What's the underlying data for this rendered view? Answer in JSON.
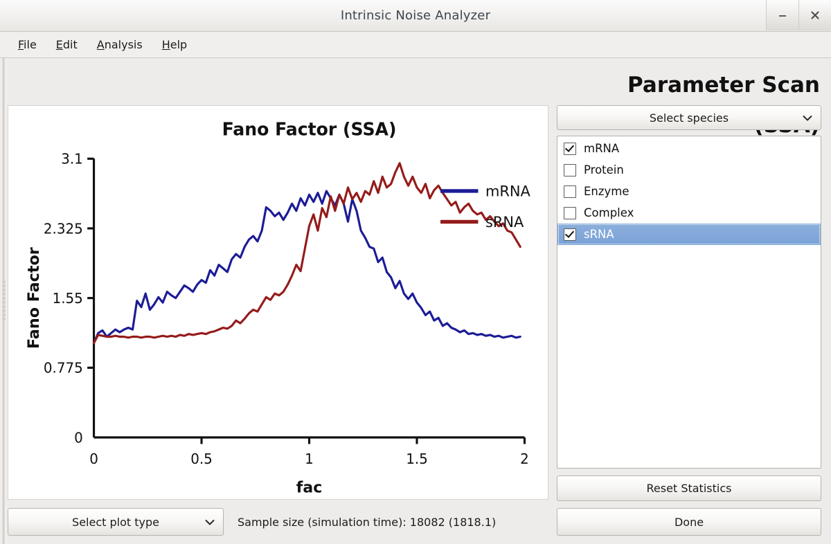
{
  "window": {
    "title": "Intrinsic Noise Analyzer",
    "minimize_label": "minimize",
    "close_label": "close"
  },
  "menubar": {
    "items": [
      {
        "label": "File",
        "mnemonic": "F"
      },
      {
        "label": "Edit",
        "mnemonic": "E"
      },
      {
        "label": "Analysis",
        "mnemonic": "A"
      },
      {
        "label": "Help",
        "mnemonic": "H"
      }
    ]
  },
  "page": {
    "title": "Parameter Scan (SSA)"
  },
  "toolbar": {
    "plot_type_label": "Select plot type",
    "sample_size_text": "Sample size (simulation time): 18082 (1818.1)"
  },
  "sidebar": {
    "species_combo_label": "Select species",
    "species": [
      {
        "label": "mRNA",
        "checked": true,
        "selected": false
      },
      {
        "label": "Protein",
        "checked": false,
        "selected": false
      },
      {
        "label": "Enzyme",
        "checked": false,
        "selected": false
      },
      {
        "label": "Complex",
        "checked": false,
        "selected": false
      },
      {
        "label": "sRNA",
        "checked": true,
        "selected": true
      }
    ],
    "reset_label": "Reset Statistics",
    "done_label": "Done"
  },
  "chart_data": {
    "type": "line",
    "title": "Fano Factor (SSA)",
    "xlabel": "fac",
    "ylabel": "Fano Factor",
    "xlim": [
      0,
      2
    ],
    "ylim": [
      0,
      3.1
    ],
    "xticks": [
      0,
      0.5,
      1,
      1.5,
      2
    ],
    "xtick_labels": [
      "0",
      "0.5",
      "1",
      "1.5",
      "2"
    ],
    "yticks": [
      0,
      0.775,
      1.55,
      2.325,
      3.1
    ],
    "ytick_labels": [
      "0",
      "0.775",
      "1.55",
      "2.325",
      "3.1"
    ],
    "grid": false,
    "legend_position": "right",
    "colors": {
      "mRNA": "#1c1c96",
      "sRNA": "#951b1b",
      "axis": "#111111",
      "background": "#ffffff"
    },
    "series": [
      {
        "name": "mRNA",
        "color": "#1c1c96",
        "x": [
          0,
          0.02,
          0.04,
          0.06,
          0.08,
          0.1,
          0.12,
          0.14,
          0.16,
          0.18,
          0.2,
          0.22,
          0.24,
          0.26,
          0.28,
          0.3,
          0.32,
          0.34,
          0.36,
          0.38,
          0.4,
          0.42,
          0.44,
          0.46,
          0.48,
          0.5,
          0.52,
          0.54,
          0.56,
          0.58,
          0.6,
          0.62,
          0.64,
          0.66,
          0.68,
          0.7,
          0.72,
          0.74,
          0.76,
          0.78,
          0.8,
          0.82,
          0.84,
          0.86,
          0.88,
          0.9,
          0.92,
          0.94,
          0.96,
          0.98,
          1,
          1.02,
          1.04,
          1.06,
          1.08,
          1.1,
          1.12,
          1.14,
          1.16,
          1.18,
          1.2,
          1.22,
          1.24,
          1.26,
          1.28,
          1.3,
          1.32,
          1.34,
          1.36,
          1.38,
          1.4,
          1.42,
          1.44,
          1.46,
          1.48,
          1.5,
          1.52,
          1.54,
          1.56,
          1.58,
          1.6,
          1.62,
          1.64,
          1.66,
          1.68,
          1.7,
          1.72,
          1.74,
          1.76,
          1.78,
          1.8,
          1.82,
          1.84,
          1.86,
          1.88,
          1.9,
          1.92,
          1.94,
          1.96,
          1.98,
          2
        ],
        "y": [
          1.05,
          1.16,
          1.19,
          1.12,
          1.16,
          1.2,
          1.17,
          1.2,
          1.22,
          1.2,
          1.52,
          1.45,
          1.6,
          1.42,
          1.48,
          1.56,
          1.5,
          1.62,
          1.58,
          1.55,
          1.62,
          1.69,
          1.66,
          1.62,
          1.7,
          1.75,
          1.72,
          1.86,
          1.8,
          1.92,
          1.88,
          1.84,
          1.98,
          2.04,
          2.0,
          2.12,
          2.2,
          2.24,
          2.18,
          2.3,
          2.56,
          2.52,
          2.46,
          2.5,
          2.42,
          2.5,
          2.6,
          2.52,
          2.66,
          2.58,
          2.7,
          2.62,
          2.72,
          2.6,
          2.74,
          2.66,
          2.58,
          2.7,
          2.6,
          2.4,
          2.65,
          2.52,
          2.3,
          2.22,
          2.12,
          2.1,
          1.95,
          2.0,
          1.84,
          1.78,
          1.66,
          1.74,
          1.6,
          1.54,
          1.6,
          1.5,
          1.44,
          1.36,
          1.4,
          1.3,
          1.33,
          1.24,
          1.27,
          1.22,
          1.2,
          1.17,
          1.19,
          1.15,
          1.16,
          1.14,
          1.15,
          1.13,
          1.14,
          1.12,
          1.13,
          1.11,
          1.12,
          1.13,
          1.11,
          1.12
        ]
      },
      {
        "name": "sRNA",
        "color": "#951b1b",
        "x": [
          0,
          0.02,
          0.04,
          0.06,
          0.08,
          0.1,
          0.12,
          0.14,
          0.16,
          0.18,
          0.2,
          0.22,
          0.24,
          0.26,
          0.28,
          0.3,
          0.32,
          0.34,
          0.36,
          0.38,
          0.4,
          0.42,
          0.44,
          0.46,
          0.48,
          0.5,
          0.52,
          0.54,
          0.56,
          0.58,
          0.6,
          0.62,
          0.64,
          0.66,
          0.68,
          0.7,
          0.72,
          0.74,
          0.76,
          0.78,
          0.8,
          0.82,
          0.84,
          0.86,
          0.88,
          0.9,
          0.92,
          0.94,
          0.96,
          0.98,
          1,
          1.02,
          1.04,
          1.06,
          1.08,
          1.1,
          1.12,
          1.14,
          1.16,
          1.18,
          1.2,
          1.22,
          1.24,
          1.26,
          1.28,
          1.3,
          1.32,
          1.34,
          1.36,
          1.38,
          1.4,
          1.42,
          1.44,
          1.46,
          1.48,
          1.5,
          1.52,
          1.54,
          1.56,
          1.58,
          1.6,
          1.62,
          1.64,
          1.66,
          1.68,
          1.7,
          1.72,
          1.74,
          1.76,
          1.78,
          1.8,
          1.82,
          1.84,
          1.86,
          1.88,
          1.9,
          1.92,
          1.94,
          1.96,
          1.98,
          2
        ],
        "y": [
          1.05,
          1.14,
          1.13,
          1.12,
          1.12,
          1.13,
          1.12,
          1.12,
          1.11,
          1.12,
          1.12,
          1.11,
          1.12,
          1.12,
          1.11,
          1.12,
          1.13,
          1.12,
          1.13,
          1.12,
          1.14,
          1.13,
          1.15,
          1.14,
          1.15,
          1.16,
          1.15,
          1.17,
          1.18,
          1.2,
          1.22,
          1.21,
          1.24,
          1.3,
          1.27,
          1.32,
          1.38,
          1.42,
          1.4,
          1.48,
          1.56,
          1.53,
          1.6,
          1.58,
          1.62,
          1.7,
          1.8,
          1.92,
          1.85,
          2.1,
          2.35,
          2.48,
          2.3,
          2.55,
          2.45,
          2.68,
          2.52,
          2.7,
          2.6,
          2.78,
          2.65,
          2.72,
          2.62,
          2.74,
          2.7,
          2.85,
          2.72,
          2.9,
          2.78,
          2.82,
          2.95,
          3.05,
          2.9,
          2.8,
          2.9,
          2.78,
          2.72,
          2.82,
          2.66,
          2.75,
          2.8,
          2.72,
          2.65,
          2.58,
          2.62,
          2.5,
          2.56,
          2.6,
          2.52,
          2.48,
          2.5,
          2.42,
          2.46,
          2.4,
          2.35,
          2.38,
          2.3,
          2.28,
          2.2,
          2.12
        ]
      }
    ]
  }
}
